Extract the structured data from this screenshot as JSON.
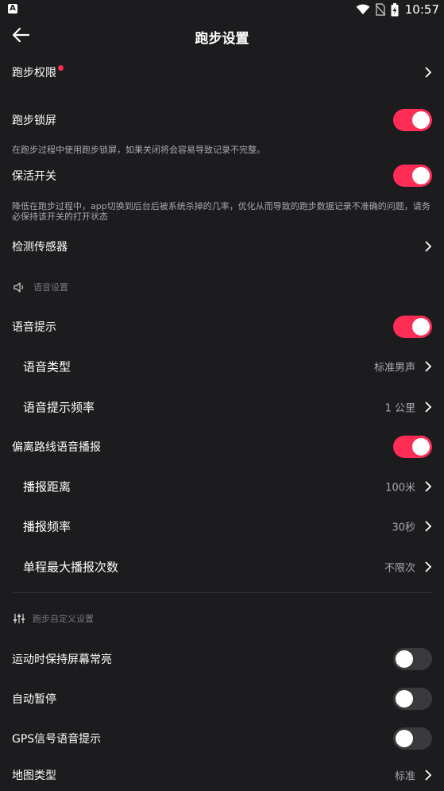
{
  "status_bar": {
    "app_indicator": "A",
    "time": "10:57"
  },
  "header": {
    "title": "跑步设置"
  },
  "rows": {
    "run_permission": {
      "label": "跑步权限"
    },
    "run_lock": {
      "label": "跑步锁屏",
      "on": true,
      "desc": "在跑步过程中使用跑步锁屏，如果关闭将会容易导致记录不完整。"
    },
    "keep_alive": {
      "label": "保活开关",
      "on": true,
      "desc": "降低在跑步过程中，app切换到后台后被系统杀掉的几率，优化从而导致的跑步数据记录不准确的问题，请务必保持该开关的打开状态"
    },
    "sensor": {
      "label": "检测传感器"
    }
  },
  "voice_section": {
    "title": "语音设置",
    "voice_prompt": {
      "label": "语音提示",
      "on": true
    },
    "voice_type": {
      "label": "语音类型",
      "value": "标准男声"
    },
    "voice_freq": {
      "label": "语音提示频率",
      "value": "1 公里"
    },
    "offroute": {
      "label": "偏离路线语音播报",
      "on": true
    },
    "broadcast_distance": {
      "label": "播报距离",
      "value": "100米"
    },
    "broadcast_freq": {
      "label": "播报频率",
      "value": "30秒"
    },
    "max_broadcasts": {
      "label": "单程最大播报次数",
      "value": "不限次"
    }
  },
  "custom_section": {
    "title": "跑步自定义设置",
    "screen_on": {
      "label": "运动时保持屏幕常亮",
      "on": false
    },
    "auto_pause": {
      "label": "自动暂停",
      "on": false
    },
    "gps_voice": {
      "label": "GPS信号语音提示",
      "on": false
    },
    "map_type": {
      "label": "地图类型",
      "value": "标准"
    }
  },
  "colors": {
    "accent": "#ff2d55",
    "background": "#1c1c1e",
    "toggle_off": "#3a3a3d",
    "secondary_text": "#a9a9ae"
  }
}
